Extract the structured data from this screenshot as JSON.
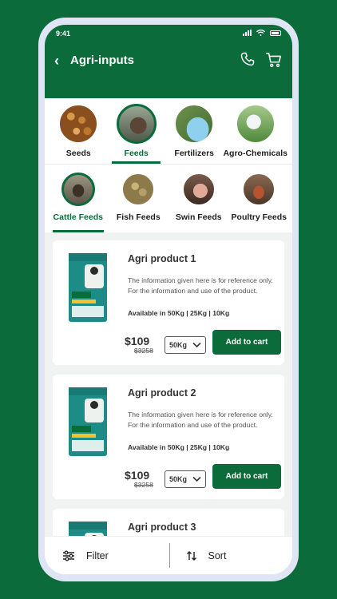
{
  "status": {
    "time": "9:41"
  },
  "header": {
    "title": "Agri-inputs",
    "icons": [
      "back-chevron",
      "phone-icon",
      "cart-icon"
    ]
  },
  "categories": [
    {
      "label": "Seeds",
      "active": false
    },
    {
      "label": "Feeds",
      "active": true
    },
    {
      "label": "Fertilizers",
      "active": false
    },
    {
      "label": "Agro-Chemicals",
      "active": false
    }
  ],
  "subcategories": [
    {
      "label": "Cattle Feeds",
      "active": true
    },
    {
      "label": "Fish Feeds",
      "active": false
    },
    {
      "label": "Swin Feeds",
      "active": false
    },
    {
      "label": "Poultry Feeds",
      "active": false
    }
  ],
  "products": [
    {
      "name": "Agri product 1",
      "description": "The information given here is for reference only. For the information and use of the product.",
      "availability": "Available in  50Kg | 25Kg | 10Kg",
      "price": "$109",
      "old_price": "$3258",
      "selected_size": "50Kg",
      "cta": "Add to cart"
    },
    {
      "name": "Agri product 2",
      "description": "The information given here is for reference only. For the information and use of the product.",
      "availability": "Available in  50Kg | 25Kg | 10Kg",
      "price": "$109",
      "old_price": "$3258",
      "selected_size": "50Kg",
      "cta": "Add to cart"
    },
    {
      "name": "Agri product 3"
    }
  ],
  "bottom_bar": {
    "filter_label": "Filter",
    "sort_label": "Sort"
  },
  "colors": {
    "brand": "#0b6b3a",
    "background": "#f1f3f2"
  }
}
